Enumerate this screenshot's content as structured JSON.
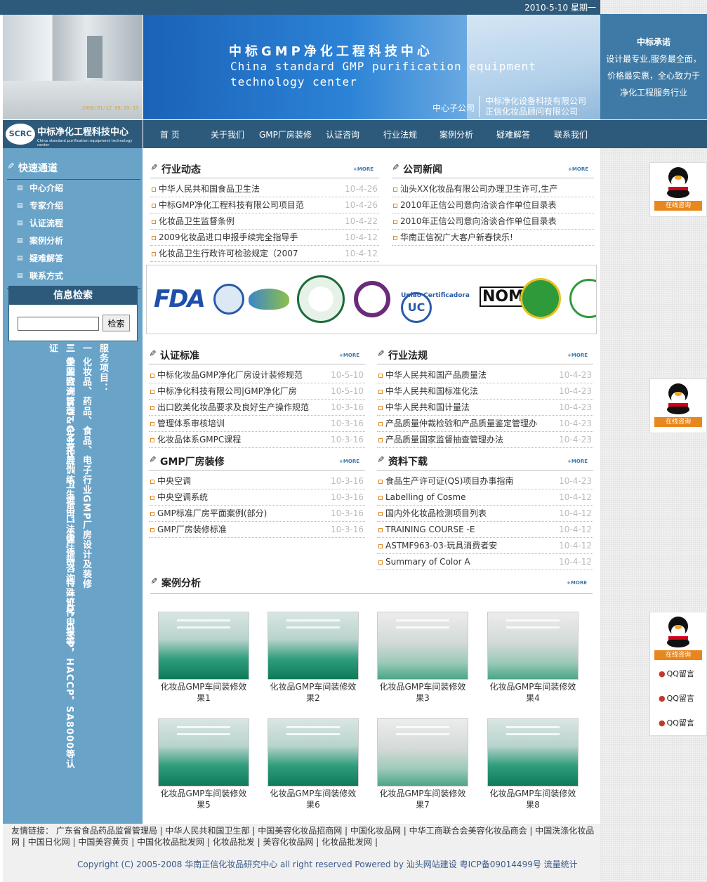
{
  "header": {
    "date": "2010-5-10 星期一",
    "photo_timestamp": "2008/01/12 08:19:33",
    "banner_title_cn": "中标GMP净化工程科技中心",
    "banner_title_en_1": "China standard GMP purification equipment",
    "banner_title_en_2": "technology center",
    "subsidiary_label": "中心子公司",
    "subsidiaries": [
      "中标净化设备科技有限公司",
      "正信化妆品顾问有限公司"
    ]
  },
  "promise": {
    "title": "中标承诺",
    "lines": [
      "设计最专业,服务最全面，",
      "价格最实惠，全心致力于",
      "净化工程服务行业"
    ]
  },
  "logo": {
    "abbr": "SCRC",
    "name": "中标净化工程科技中心",
    "en": "China standard purification equipment technology center"
  },
  "nav": [
    "首 页",
    "关于我们",
    "GMP厂房装修",
    "认证咨询",
    "行业法规",
    "案例分析",
    "疑难解答",
    "联系我们"
  ],
  "sidebar": {
    "quick_title": "快速通道",
    "items": [
      "中心介绍",
      "专家介绍",
      "认证流程",
      "案例分析",
      "疑难解答",
      "联系方式"
    ],
    "search_title": "信息检索",
    "search_button": "检索",
    "services_title": "服务项目：",
    "services": [
      "一 化妆品、药品、食品、电子行业GMP厂房设计及装修",
      "二 美国欧洲ISO&GMP认证，卫生许可、生产许可、特殊证件申报等",
      "三 企业咨询管理，企业拓展训练，进出口法律法规咨询，ISO，GMP，HACCP，SA8000等认证"
    ]
  },
  "more_label": "+MORE",
  "sections": {
    "industry_news": {
      "title": "行业动态",
      "items": [
        {
          "text": "中华人民共和国食品卫生法",
          "date": "10-4-26"
        },
        {
          "text": "中标GMP净化工程科技有限公司项目范",
          "date": "10-4-26"
        },
        {
          "text": "化妆品卫生监督条例",
          "date": "10-4-22"
        },
        {
          "text": "2009化妆品进口申报手续完全指导手",
          "date": "10-4-12"
        },
        {
          "text": "化妆品卫生行政许可检验规定（2007",
          "date": "10-4-12"
        }
      ]
    },
    "company_news": {
      "title": "公司新闻",
      "items": [
        {
          "text": "汕头XX化妆品有限公司办理卫生许可,生产"
        },
        {
          "text": "2010年正信公司意向洽谈合作单位目录表"
        },
        {
          "text": "2010年正信公司意向洽谈合作单位目录表"
        },
        {
          "text": "华南正信祝广大客户新春快乐!"
        }
      ]
    },
    "cert_standards": {
      "title": "认证标准",
      "items": [
        {
          "text": "中标化妆品GMP净化厂房设计装修规范",
          "date": "10-5-10"
        },
        {
          "text": "中标净化科技有限公司|GMP净化厂房",
          "date": "10-5-10"
        },
        {
          "text": "出口欧美化妆品要求及良好生产操作规范",
          "date": "10-3-16"
        },
        {
          "text": "管理体系审核培训",
          "date": "10-3-16"
        },
        {
          "text": "化妆品体系GMPC课程",
          "date": "10-3-16"
        }
      ]
    },
    "regulations": {
      "title": "行业法规",
      "items": [
        {
          "text": "中华人民共和国产品质量法",
          "date": "10-4-23"
        },
        {
          "text": "中华人民共和国标准化法",
          "date": "10-4-23"
        },
        {
          "text": "中华人民共和国计量法",
          "date": "10-4-23"
        },
        {
          "text": "产品质量仲裁检验和产品质量鉴定管理办",
          "date": "10-4-23"
        },
        {
          "text": "产品质量国家监督抽查管理办法",
          "date": "10-4-23"
        }
      ]
    },
    "gmp_decoration": {
      "title": "GMP厂房装修",
      "items": [
        {
          "text": "中央空调",
          "date": "10-3-16"
        },
        {
          "text": "中央空调系统",
          "date": "10-3-16"
        },
        {
          "text": "GMP标准厂房平面案例(部分)",
          "date": "10-3-16"
        },
        {
          "text": "GMP厂房装修标准",
          "date": "10-3-16"
        }
      ]
    },
    "downloads": {
      "title": "资料下载",
      "items": [
        {
          "text": "食品生产许可证(QS)项目办事指南",
          "date": "10-4-23"
        },
        {
          "text": "Labelling of Cosme",
          "date": "10-4-12"
        },
        {
          "text": "国内外化妆品检测项目列表",
          "date": "10-4-12"
        },
        {
          "text": "TRAINING COURSE -E",
          "date": "10-4-12"
        },
        {
          "text": "ASTMF963-03-玩具消费者安",
          "date": "10-4-12"
        },
        {
          "text": "Summary of Color A",
          "date": "10-4-12"
        }
      ]
    },
    "cases": {
      "title": "案例分析",
      "items": [
        "化妆品GMP车间装修效果1",
        "化妆品GMP车间装修效果2",
        "化妆品GMP车间装修效果3",
        "化妆品GMP车间装修效果4",
        "化妆品GMP车间装修效果5",
        "化妆品GMP车间装修效果6",
        "化妆品GMP车间装修效果7",
        "化妆品GMP车间装修效果8"
      ]
    }
  },
  "cert_logos": [
    "FDA",
    "NOM",
    "União Certificadora",
    "UC"
  ],
  "qq": {
    "online": "在线咨询",
    "message": "QQ留言"
  },
  "footer": {
    "links_label": "友情链接：",
    "links": [
      "广东省食品药品监督管理局",
      "中华人民共和国卫生部",
      "中国美容化妆品招商网",
      "中国化妆品网",
      "中华工商联合会美容化妆品商会",
      "中国洗涤化妆品网",
      "中国日化网",
      "中国美容黄页",
      "中国化妆品批发网",
      "化妆品批发",
      "美容化妆品网",
      "化妆品批发网"
    ],
    "copyright": "Copyright (C) 2005-2008 华南正信化妆品研究中心  all right reserved Powered by 汕头网站建设 粤ICP备09014499号   流量统计"
  }
}
